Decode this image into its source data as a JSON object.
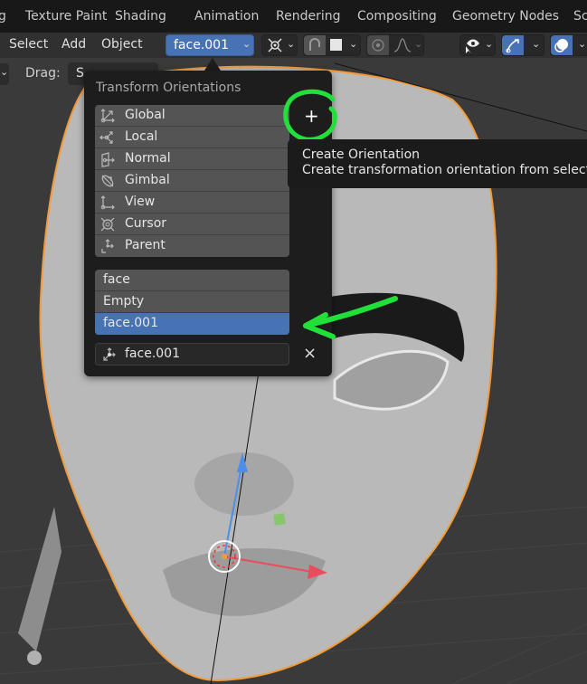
{
  "workspace_tabs": [
    "g",
    "Texture Paint",
    "Shading",
    "Animation",
    "Rendering",
    "Compositing",
    "Geometry Nodes",
    "Sc"
  ],
  "header": {
    "menus": [
      "Select",
      "Add",
      "Object"
    ],
    "orientation_dropdown": "face.001",
    "icons": [
      "pivot-point-icon",
      "snap-icon",
      "snap-target-icon",
      "proportional-edit-icon",
      "falloff-icon",
      "visibility-icon",
      "gizmo-icon",
      "overlay-icon"
    ]
  },
  "tool_options": {
    "drag_label": "Drag:",
    "drag_value": "S"
  },
  "popup": {
    "title": "Transform Orientations",
    "builtin": [
      {
        "label": "Global",
        "icon": "orientation-global-icon"
      },
      {
        "label": "Local",
        "icon": "orientation-local-icon"
      },
      {
        "label": "Normal",
        "icon": "orientation-normal-icon"
      },
      {
        "label": "Gimbal",
        "icon": "orientation-gimbal-icon"
      },
      {
        "label": "View",
        "icon": "orientation-view-icon"
      },
      {
        "label": "Cursor",
        "icon": "orientation-cursor-icon"
      },
      {
        "label": "Parent",
        "icon": "orientation-parent-icon"
      }
    ],
    "custom": [
      {
        "label": "face",
        "selected": false
      },
      {
        "label": "Empty",
        "selected": false
      },
      {
        "label": "face.001",
        "selected": true
      }
    ],
    "name_field": "face.001",
    "add_button": "+",
    "delete_button": "×"
  },
  "tooltip": {
    "title": "Create Orientation",
    "description": "Create transformation orientation from selection."
  },
  "colors": {
    "accent": "#4772b3",
    "annotation": "#22e03a",
    "selection_outline": "#f29b38"
  }
}
